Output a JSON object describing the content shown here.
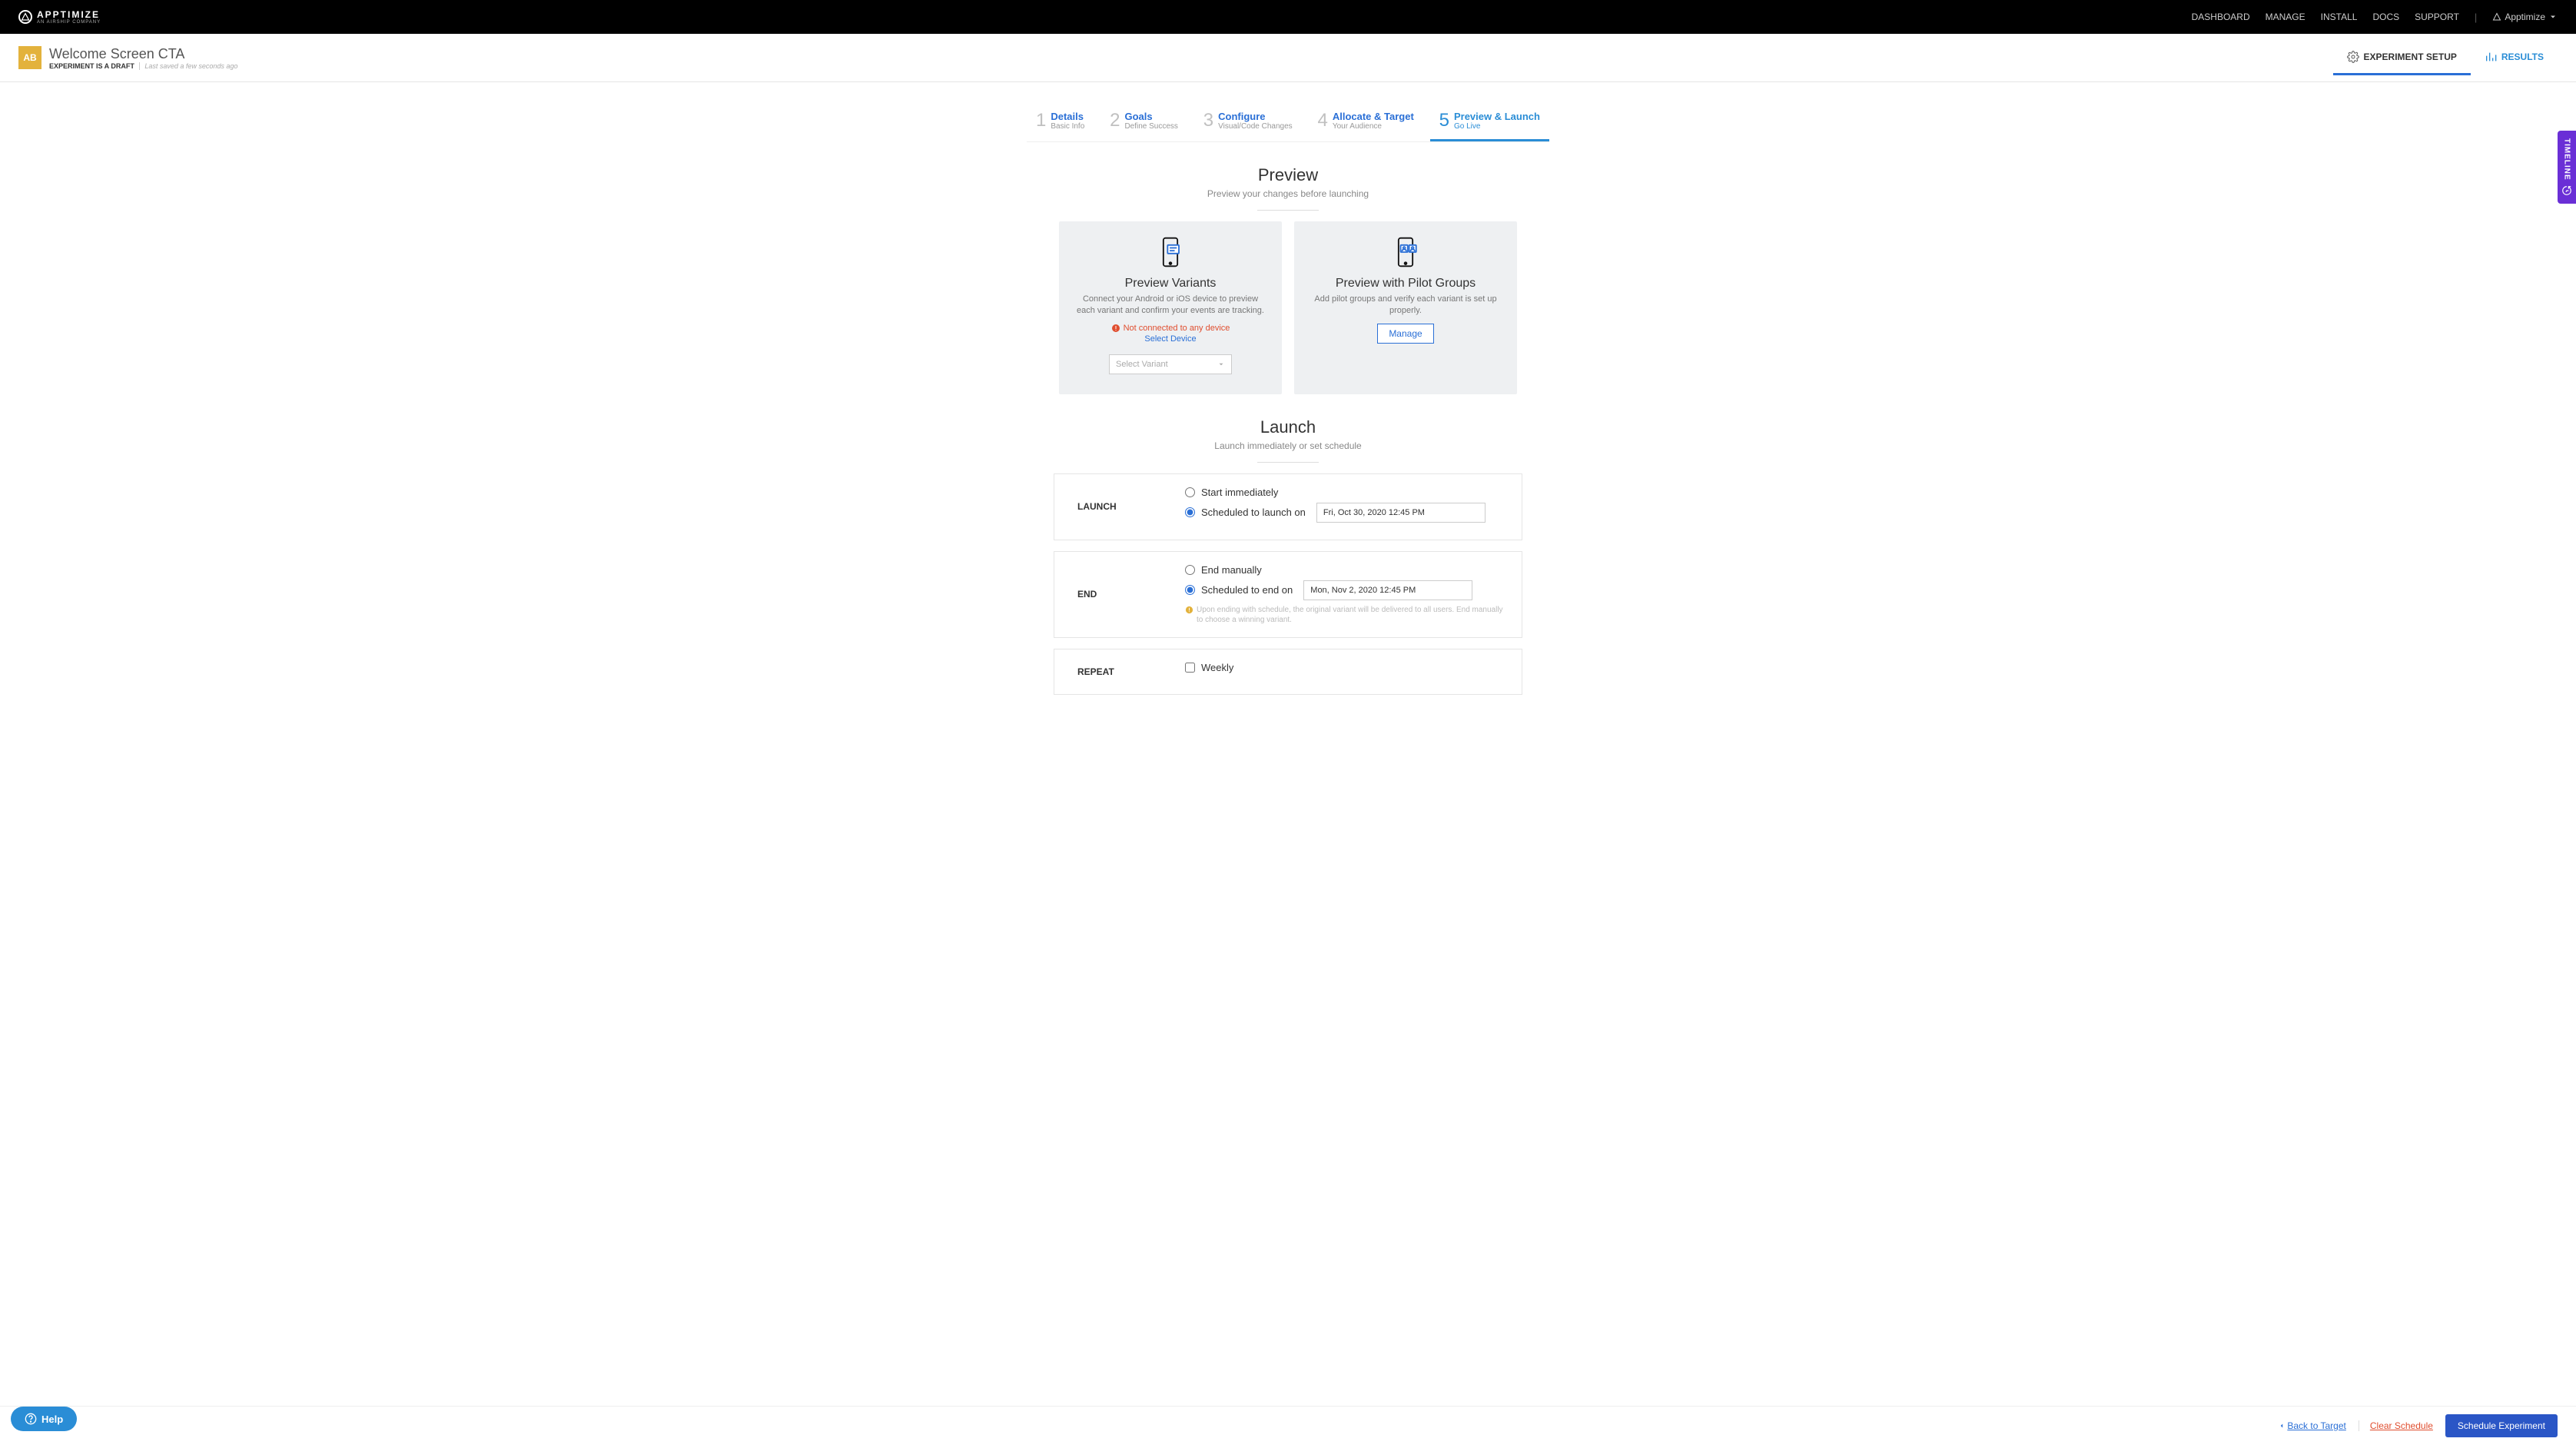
{
  "brand": {
    "name": "APPTIMIZE",
    "sub": "AN AIRSHIP COMPANY"
  },
  "nav": {
    "dashboard": "DASHBOARD",
    "manage": "MANAGE",
    "install": "INSTALL",
    "docs": "DOCS",
    "support": "SUPPORT",
    "app_menu": "Apptimize"
  },
  "experiment": {
    "badge": "AB",
    "name": "Welcome Screen CTA",
    "status": "EXPERIMENT IS A DRAFT",
    "saved": "Last saved a few seconds ago"
  },
  "tabs_right": {
    "setup": "EXPERIMENT SETUP",
    "results": "RESULTS"
  },
  "steps": [
    {
      "num": "1",
      "name": "Details",
      "sub": "Basic Info"
    },
    {
      "num": "2",
      "name": "Goals",
      "sub": "Define Success"
    },
    {
      "num": "3",
      "name": "Configure",
      "sub": "Visual/Code Changes"
    },
    {
      "num": "4",
      "name": "Allocate & Target",
      "sub": "Your Audience"
    },
    {
      "num": "5",
      "name": "Preview & Launch",
      "sub": "Go Live"
    }
  ],
  "preview": {
    "heading": "Preview",
    "subtitle": "Preview your changes before launching",
    "variants": {
      "title": "Preview Variants",
      "desc": "Connect your Android or iOS device to preview each variant and confirm your events are tracking.",
      "not_connected": "Not connected to any device",
      "select_device": "Select Device",
      "select_variant": "Select Variant"
    },
    "pilot": {
      "title": "Preview with Pilot Groups",
      "desc": "Add pilot groups and verify each variant is set up properly.",
      "manage": "Manage"
    }
  },
  "launch": {
    "heading": "Launch",
    "subtitle": "Launch immediately or set schedule",
    "launch_label": "LAUNCH",
    "start_immediately": "Start immediately",
    "scheduled_launch": "Scheduled to launch on",
    "launch_date": "Fri, Oct 30, 2020 12:45 PM",
    "end_label": "END",
    "end_manually": "End manually",
    "scheduled_end": "Scheduled to end on",
    "end_date": "Mon, Nov 2, 2020 12:45 PM",
    "end_warn": "Upon ending with schedule, the original variant will be delivered to all users. End manually to choose a winning variant.",
    "repeat_label": "REPEAT",
    "weekly": "Weekly"
  },
  "footer": {
    "back": "Back to Target",
    "clear": "Clear Schedule",
    "schedule": "Schedule Experiment"
  },
  "help": "Help",
  "timeline": "TIMELINE"
}
